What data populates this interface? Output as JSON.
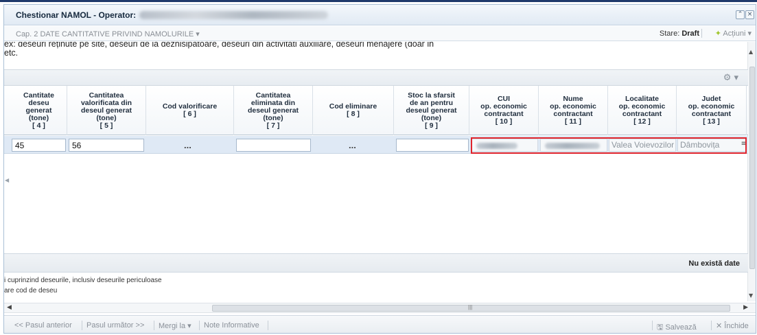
{
  "window": {
    "title": "Chestionar NAMOL - Operator:",
    "restore_symbol": "⌃",
    "close_symbol": "×"
  },
  "subbar": {
    "chapter": "Cap. 2 DATE CANTITATIVE PRIVIND NAMOLURILE ▾",
    "state_label": "Stare:",
    "state_value": "Draft",
    "actions_label": "Acțiuni ▾",
    "actions_icon": "✦"
  },
  "description": {
    "line1": "ex: deseuri reținute pe site, deseuri de la deznisipatoare, deseuri din activitati auxiliare, deseuri menajere (doar in",
    "line2": "etc."
  },
  "grid": {
    "settings_icon": "⚙ ▾",
    "columns": [
      {
        "label": "Cantitate\ndeseu\ngenerat\n(tone)\n[ 4 ]"
      },
      {
        "label": "Cantitatea\nvalorificata din\ndeseul generat\n(tone)\n[ 5 ]"
      },
      {
        "label": "Cod valorificare\n[ 6 ]"
      },
      {
        "label": "Cantitatea\neliminata din\ndeseul generat\n(tone)\n[ 7 ]"
      },
      {
        "label": "Cod eliminare\n[ 8 ]"
      },
      {
        "label": "Stoc la sfarsit\nde an pentru\ndeseul generat\n(tone)\n[ 9 ]"
      },
      {
        "label": "CUI\nop. economic\ncontractant\n[ 10 ]"
      },
      {
        "label": "Nume\nop. economic\ncontractant\n[ 11 ]"
      },
      {
        "label": "Localitate\nop. economic\ncontractant\n[ 12 ]"
      },
      {
        "label": "Judet\nop. economic\ncontractant\n[ 13 ]"
      }
    ],
    "row": {
      "cantitate_generat": "45",
      "cantitate_valorificata": "56",
      "cod_valorificare": "...",
      "cantitate_eliminata": "",
      "cod_eliminare": "...",
      "stoc": "",
      "localitate": "Valea Voievozilor",
      "judet": "Dâmbovița",
      "row_menu": "≡"
    }
  },
  "footer": {
    "no_data": "Nu există date",
    "note1": "i cuprinzind deseurile, inclusiv deseurile periculoase",
    "note2": "are cod de deseu"
  },
  "bottombar": {
    "prev": "<< Pasul anterior",
    "next": "Pasul următor >>",
    "goto": "Mergi la ▾",
    "info": "Note Informative",
    "save": "Salvează",
    "close": "Închide"
  }
}
